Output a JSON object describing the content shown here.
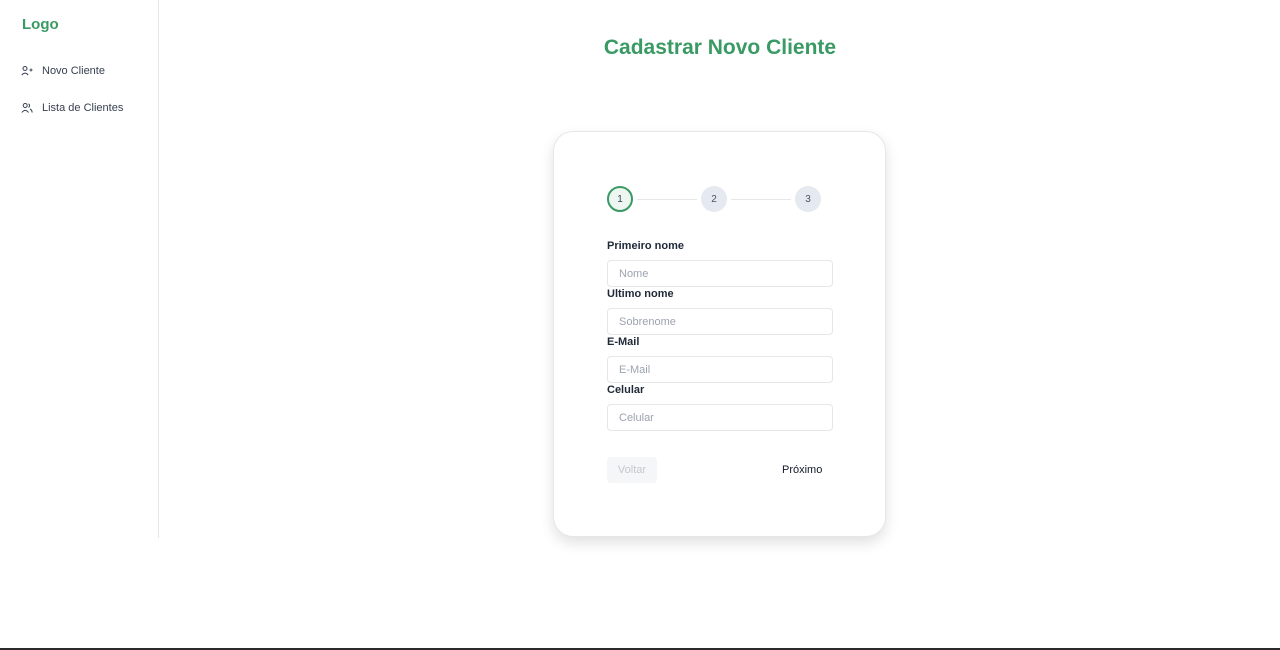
{
  "sidebar": {
    "logo": "Logo",
    "items": [
      {
        "label": "Novo Cliente",
        "icon": "user-plus-icon"
      },
      {
        "label": "Lista de Clientes",
        "icon": "users-icon"
      }
    ]
  },
  "main": {
    "title": "Cadastrar Novo Cliente"
  },
  "stepper": {
    "steps": [
      "1",
      "2",
      "3"
    ],
    "current": 1
  },
  "form": {
    "first_name": {
      "label": "Primeiro nome",
      "placeholder": "Nome",
      "value": ""
    },
    "last_name": {
      "label": "Ultimo nome",
      "placeholder": "Sobrenome",
      "value": ""
    },
    "email": {
      "label": "E-Mail",
      "placeholder": "E-Mail",
      "value": ""
    },
    "phone": {
      "label": "Celular",
      "placeholder": "Celular",
      "value": ""
    }
  },
  "actions": {
    "back_label": "Voltar",
    "next_label": "Próximo"
  },
  "colors": {
    "accent": "#3a9a64",
    "border": "#e5e7eb",
    "step_inactive": "#e5e9f0"
  }
}
